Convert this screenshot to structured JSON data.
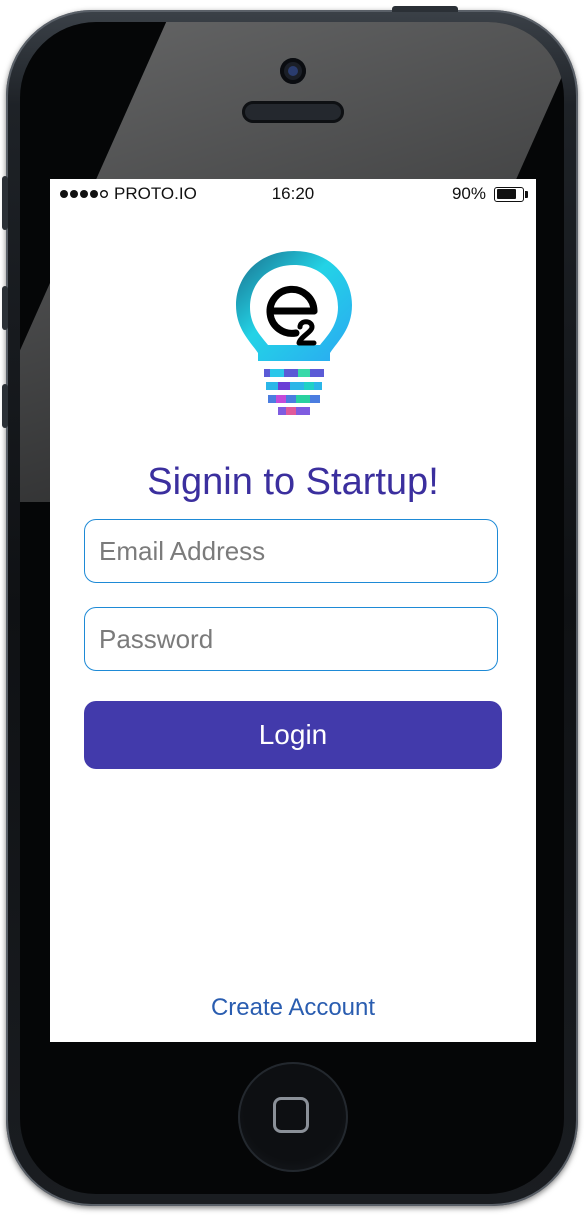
{
  "status_bar": {
    "carrier": "PROTO.IO",
    "signal_bars": 4,
    "signal_total": 5,
    "time": "16:20",
    "battery": "90%",
    "battery_level": 0.9
  },
  "logo": {
    "icon": "lightbulb-icon"
  },
  "title": "Signin to Startup!",
  "email_field": {
    "placeholder": "Email Address",
    "value": ""
  },
  "password_field": {
    "placeholder": "Password",
    "value": ""
  },
  "login_button": {
    "label": "Login"
  },
  "create_account": {
    "label": "Create Account"
  },
  "colors": {
    "title": "#3b2f9e",
    "button": "#423aab",
    "field_border": "#1e8ad6",
    "link": "#2a5db0",
    "logo_accent": "#23d3e6"
  }
}
